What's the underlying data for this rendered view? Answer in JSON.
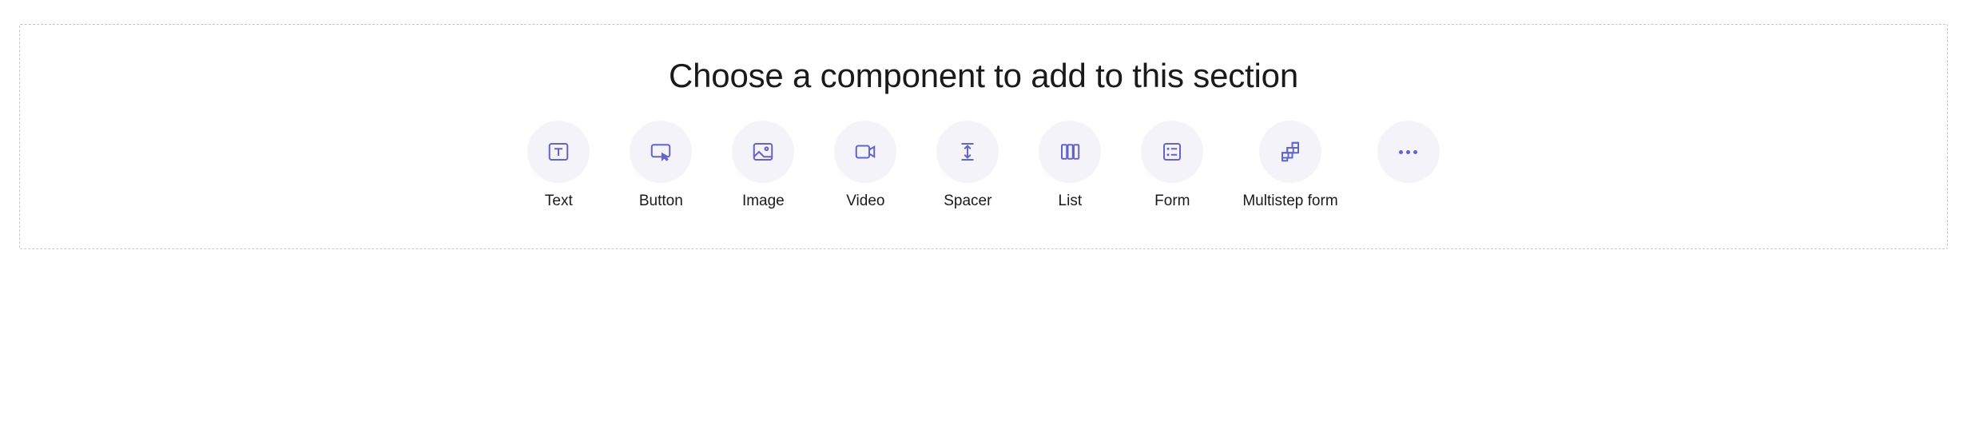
{
  "section": {
    "heading": "Choose a component to add to this section",
    "options": {
      "text": {
        "label": "Text"
      },
      "button": {
        "label": "Button"
      },
      "image": {
        "label": "Image"
      },
      "video": {
        "label": "Video"
      },
      "spacer": {
        "label": "Spacer"
      },
      "list": {
        "label": "List"
      },
      "form": {
        "label": "Form"
      },
      "multistep_form": {
        "label": "Multistep form"
      }
    }
  },
  "colors": {
    "icon_accent": "#6264c7",
    "icon_bg": "#f4f3fa",
    "border": "#c8c8c8"
  }
}
